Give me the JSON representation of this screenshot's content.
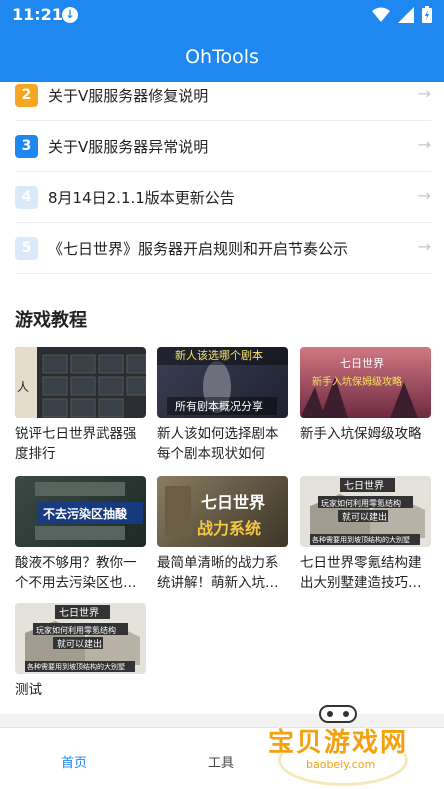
{
  "status_bar": {
    "time": "11:21"
  },
  "app_bar": {
    "title": "OhTools"
  },
  "news": [
    {
      "rank": "2",
      "title": "关于V服服务器修复说明",
      "color": "#f5a623"
    },
    {
      "rank": "3",
      "title": "关于V服服务器异常说明",
      "color": "#1e88f0"
    },
    {
      "rank": "4",
      "title": "8月14日2.1.1版本更新公告",
      "color": "#dbe9fb"
    },
    {
      "rank": "5",
      "title": "《七日世界》服务器开启规则和开启节奏公示",
      "color": "#dbe9fb"
    }
  ],
  "tutorial_section": {
    "title": "游戏教程",
    "cards": [
      {
        "caption": "锐评七日世界武器强度排行",
        "thumb_text": [
          "",
          "人"
        ]
      },
      {
        "caption": "新人该如何选择剧本每个剧本现状如何",
        "thumb_text": [
          "新人该选哪个剧本",
          "所有剧本概况分享"
        ]
      },
      {
        "caption": "新手入坑保姆级攻略",
        "thumb_text": [
          "七日世界",
          "新手入坑保姆级攻略"
        ]
      },
      {
        "caption": "酸液不够用？教你一个不用去污染区也…",
        "thumb_text": [
          "不去污染区抽酸",
          ""
        ]
      },
      {
        "caption": "最简单清晰的战力系统讲解！萌新入坑…",
        "thumb_text": [
          "七日世界",
          "战力系统"
        ]
      },
      {
        "caption": "七日世界零氪结构建出大别墅建造技巧…",
        "thumb_text": [
          "七日世界",
          "玩家如何利用零氪结构",
          "就可以建出",
          "各种需要用到坡顶结构的大别墅"
        ]
      },
      {
        "caption": "测试",
        "thumb_text": [
          "七日世界",
          "玩家如何利用零氪结构",
          "就可以建出",
          "各种需要用到坡顶结构的大别墅"
        ]
      }
    ]
  },
  "tab_bar": {
    "tabs": [
      {
        "label": "首页",
        "active": true
      },
      {
        "label": "工具",
        "active": false
      }
    ]
  },
  "watermark": {
    "brand": "宝贝游戏网",
    "url": "baobeiy.com"
  },
  "colors": {
    "primary": "#1e88f0",
    "accent_orange": "#f5a623"
  }
}
